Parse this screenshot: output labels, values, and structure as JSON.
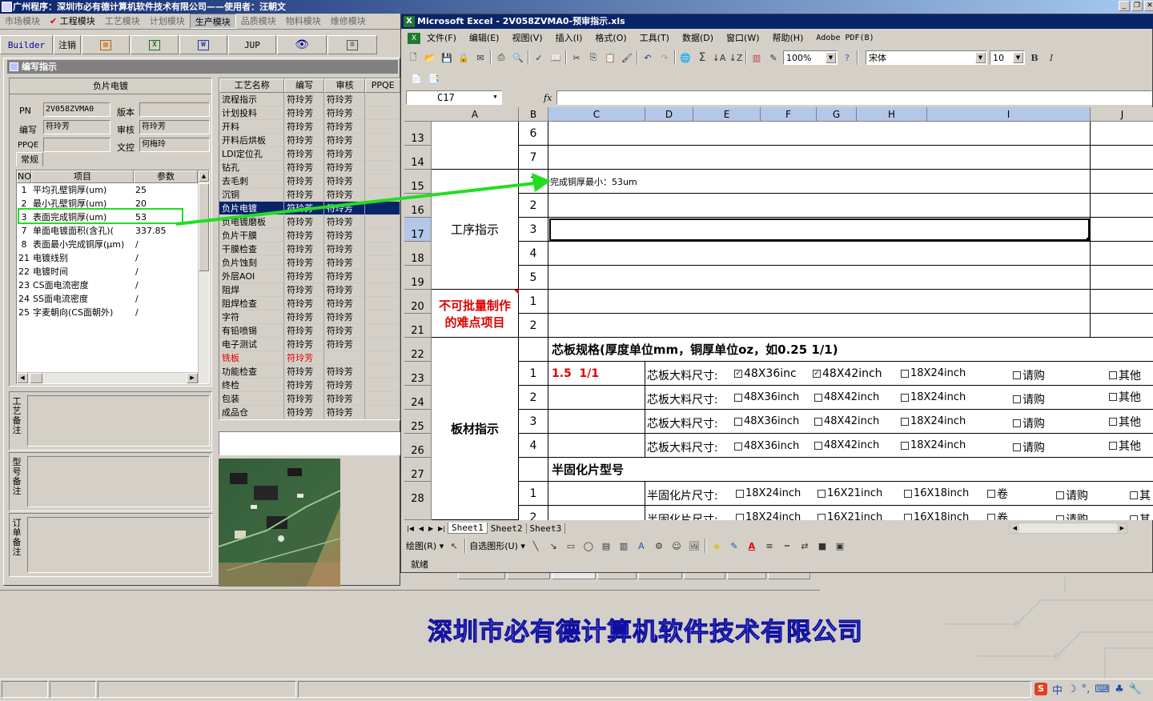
{
  "bg_app": {
    "title": "广州程序：深圳市必有德计算机软件技术有限公司——使用者：汪朝文",
    "modules": [
      "市场模块",
      "工程模块",
      "工艺模块",
      "计划模块",
      "生产模块",
      "品质模块",
      "物料模块",
      "维修模块"
    ],
    "toolbar": {
      "builder": "Builder",
      "logout": "注销",
      "excel_icon": "X",
      "word_icon": "W",
      "jup": "JUP"
    }
  },
  "editor": {
    "title": "编写指示",
    "header": "负片电镀",
    "pn_label": "PN",
    "pn_value": "2V058ZVMA0",
    "version_label": "版本",
    "version_value": "",
    "writer_label": "编写",
    "writer_value": "符玲芳",
    "reviewer_label": "审核",
    "reviewer_value": "符玲芳",
    "ppqe_label": "PPQE",
    "ppqe_value": "",
    "control_label": "文控",
    "control_value": "何梅玲",
    "tab": "常规",
    "params_headers": [
      "NO",
      "项目",
      "参数"
    ],
    "params": [
      {
        "no": "1",
        "item": "平均孔壁铜厚(um)",
        "value": "25"
      },
      {
        "no": "2",
        "item": "最小孔壁铜厚(um)",
        "value": "20"
      },
      {
        "no": "3",
        "item": "表面完成铜厚(um)",
        "value": "53"
      },
      {
        "no": "7",
        "item": "单面电镀面积(含孔)(",
        "value": "337.85"
      },
      {
        "no": "8",
        "item": "表面最小完成铜厚(μm)",
        "value": "/"
      },
      {
        "no": "21",
        "item": "电镀线别",
        "value": "/"
      },
      {
        "no": "22",
        "item": "电镀时间",
        "value": "/"
      },
      {
        "no": "23",
        "item": "CS面电流密度",
        "value": "/"
      },
      {
        "no": "24",
        "item": "SS面电流密度",
        "value": "/"
      },
      {
        "no": "25",
        "item": "字麦朝向(CS面朝外)",
        "value": "/"
      }
    ],
    "note_labels": [
      "工艺备注",
      "型号备注",
      "订单备注"
    ]
  },
  "process": {
    "headers": [
      "工艺名称",
      "编写",
      "审核",
      "PPQE"
    ],
    "rows": [
      {
        "name": "流程指示",
        "w": "符玲芳",
        "r": "符玲芳"
      },
      {
        "name": "计划投料",
        "w": "符玲芳",
        "r": "符玲芳"
      },
      {
        "name": "开料",
        "w": "符玲芳",
        "r": "符玲芳"
      },
      {
        "name": "开料后烘板",
        "w": "符玲芳",
        "r": "符玲芳"
      },
      {
        "name": "LDI定位孔",
        "w": "符玲芳",
        "r": "符玲芳"
      },
      {
        "name": "钻孔",
        "w": "符玲芳",
        "r": "符玲芳"
      },
      {
        "name": "去毛刺",
        "w": "符玲芳",
        "r": "符玲芳"
      },
      {
        "name": "沉铜",
        "w": "符玲芳",
        "r": "符玲芳"
      },
      {
        "name": "负片电镀",
        "w": "符玲芳",
        "r": "符玲芳"
      },
      {
        "name": "负电镀磨板",
        "w": "符玲芳",
        "r": "符玲芳"
      },
      {
        "name": "负片干膜",
        "w": "符玲芳",
        "r": "符玲芳"
      },
      {
        "name": "干膜检查",
        "w": "符玲芳",
        "r": "符玲芳"
      },
      {
        "name": "负片蚀刻",
        "w": "符玲芳",
        "r": "符玲芳"
      },
      {
        "name": "外层AOI",
        "w": "符玲芳",
        "r": "符玲芳"
      },
      {
        "name": "阻焊",
        "w": "符玲芳",
        "r": "符玲芳"
      },
      {
        "name": "阻焊检查",
        "w": "符玲芳",
        "r": "符玲芳"
      },
      {
        "name": "字符",
        "w": "符玲芳",
        "r": "符玲芳"
      },
      {
        "name": "有铅喷锡",
        "w": "符玲芳",
        "r": "符玲芳"
      },
      {
        "name": "电子测试",
        "w": "符玲芳",
        "r": "符玲芳"
      },
      {
        "name": "铣板",
        "w": "符玲芳",
        "r": ""
      },
      {
        "name": "功能检查",
        "w": "符玲芳",
        "r": "符玲芳"
      },
      {
        "name": "终检",
        "w": "符玲芳",
        "r": "符玲芳"
      },
      {
        "name": "包装",
        "w": "符玲芳",
        "r": "符玲芳"
      },
      {
        "name": "成品仓",
        "w": "符玲芳",
        "r": "符玲芳"
      }
    ]
  },
  "excel": {
    "title": "Microsoft Excel - 2V058ZVMA0-预审指示.xls",
    "menu": [
      "文件(F)",
      "编辑(E)",
      "视图(V)",
      "插入(I)",
      "格式(O)",
      "工具(T)",
      "数据(D)",
      "窗口(W)",
      "帮助(H)",
      "Adobe PDF(B)"
    ],
    "zoom": "100%",
    "font": "宋体",
    "size": "10",
    "namebox": "C17",
    "fx": "fx",
    "columns": [
      "A",
      "B",
      "C",
      "D",
      "E",
      "F",
      "G",
      "H",
      "I",
      "J"
    ],
    "rows": [
      "13",
      "14",
      "15",
      "16",
      "17",
      "18",
      "19",
      "20",
      "21",
      "22",
      "23",
      "24",
      "25",
      "26",
      "27",
      "28"
    ],
    "step_nums": [
      "6",
      "7",
      "1",
      "2",
      "3",
      "4",
      "5"
    ],
    "hard_nums": [
      "1",
      "2"
    ],
    "board_nums": [
      "1",
      "2",
      "3",
      "4"
    ],
    "prepreg_nums": [
      "1",
      "2"
    ],
    "label_process": "工序指示",
    "label_hard": "不可批量制作的难点项目",
    "label_board": "板材指示",
    "cell_c15": "完成铜厚最小：53um",
    "core_header": "芯板规格(厚度单位mm，铜厚单位oz，如0.25 1/1)",
    "core_value": "1.5  1/1",
    "core_label": "芯板大料尺寸:",
    "opt_48x36": "48X36inch",
    "opt_48x36_short": "48X36inc",
    "opt_48x42": "48X42inch",
    "opt_18x24": "18X24inch",
    "opt_buy": "请购",
    "opt_other": "其他",
    "prepreg_header": "半固化片型号",
    "prepreg_label": "半固化片尺寸:",
    "pp_18x24": "18X24inch",
    "pp_16x21": "16X21inch",
    "pp_16x18": "16X18inch",
    "pp_roll": "卷",
    "pp_buy": "请购",
    "pp_other_cut": "其",
    "sheets": [
      "Sheet1",
      "Sheet2",
      "Sheet3"
    ],
    "draw_label": "绘图(R)",
    "autoshape": "自选图形(U)",
    "status": "就绪"
  },
  "banner": "深圳市必有德计算机软件技术有限公司",
  "ime": {
    "label": "中"
  },
  "colors": {
    "title_active": "#0a246a",
    "selection": "#0a246a",
    "annotation": "#22dd22",
    "warn_red": "#e00000"
  }
}
